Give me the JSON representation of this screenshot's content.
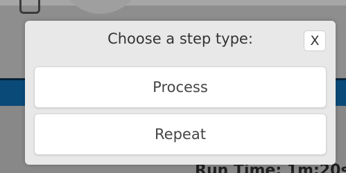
{
  "background": {
    "runtime_label": "Run Time: 1m:20s"
  },
  "modal": {
    "title": "Choose a step type:",
    "close_label": "X",
    "options": [
      {
        "label": "Process"
      },
      {
        "label": "Repeat"
      }
    ]
  },
  "colors": {
    "overlay_gray": "#8e8e8e",
    "blue_band": "#0a4a78",
    "modal_bg": "#e8e8e8",
    "button_bg": "#ffffff"
  }
}
